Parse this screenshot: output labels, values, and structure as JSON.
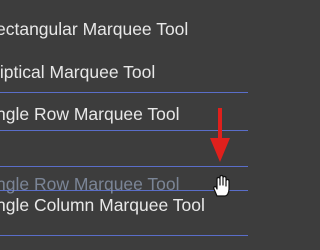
{
  "menu": {
    "items": [
      {
        "label": "ectangular Marquee Tool"
      },
      {
        "label": "liptical Marquee Tool"
      },
      {
        "label": "ngle Row Marquee Tool"
      },
      {
        "label": "ngle Column Marquee Tool"
      }
    ],
    "drag_ghost": {
      "label": "ngle Row Marquee Tool"
    }
  },
  "colors": {
    "background": "#3d3d3d",
    "text": "#e8e8e8",
    "ghost_text": "#8b98ad",
    "guide_line": "#5a6ec9",
    "arrow": "#e0201c"
  },
  "icons": {
    "arrow": "arrow-down-icon",
    "cursor": "hand-cursor-icon"
  }
}
